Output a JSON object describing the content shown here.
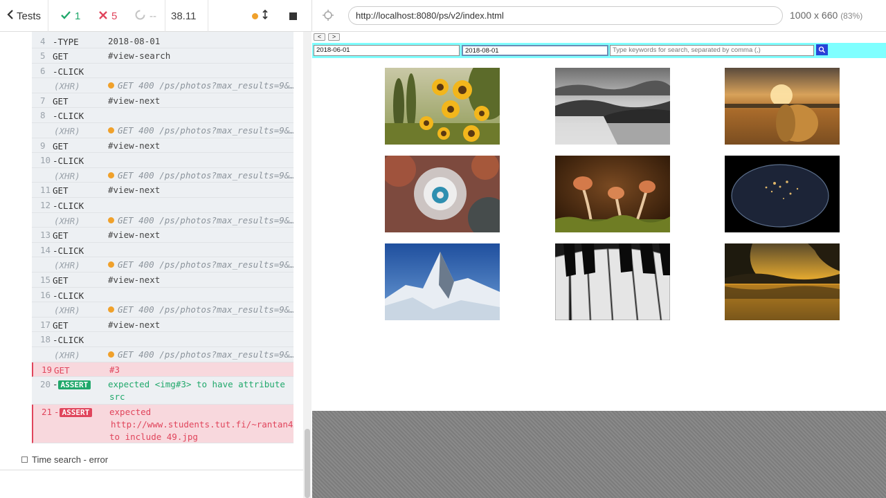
{
  "reporter": {
    "tests_label": "Tests",
    "passed_count": "1",
    "failed_count": "5",
    "pending_count": "--",
    "duration": "38.11",
    "test_title": "Time search - error",
    "commands": [
      {
        "num": "4",
        "name": "-TYPE",
        "msg": "2018-08-01",
        "type": "cmd"
      },
      {
        "num": "5",
        "name": "GET",
        "msg": "#view-search",
        "type": "cmd"
      },
      {
        "num": "6",
        "name": "-CLICK",
        "msg": "",
        "type": "cmd"
      },
      {
        "num": "",
        "name": "(XHR)",
        "msg": "GET 400 /ps/photos?max_results=9&…",
        "type": "xhr"
      },
      {
        "num": "7",
        "name": "GET",
        "msg": "#view-next",
        "type": "cmd"
      },
      {
        "num": "8",
        "name": "-CLICK",
        "msg": "",
        "type": "cmd"
      },
      {
        "num": "",
        "name": "(XHR)",
        "msg": "GET 400 /ps/photos?max_results=9&…",
        "type": "xhr"
      },
      {
        "num": "9",
        "name": "GET",
        "msg": "#view-next",
        "type": "cmd"
      },
      {
        "num": "10",
        "name": "-CLICK",
        "msg": "",
        "type": "cmd"
      },
      {
        "num": "",
        "name": "(XHR)",
        "msg": "GET 400 /ps/photos?max_results=9&…",
        "type": "xhr"
      },
      {
        "num": "11",
        "name": "GET",
        "msg": "#view-next",
        "type": "cmd"
      },
      {
        "num": "12",
        "name": "-CLICK",
        "msg": "",
        "type": "cmd"
      },
      {
        "num": "",
        "name": "(XHR)",
        "msg": "GET 400 /ps/photos?max_results=9&…",
        "type": "xhr"
      },
      {
        "num": "13",
        "name": "GET",
        "msg": "#view-next",
        "type": "cmd"
      },
      {
        "num": "14",
        "name": "-CLICK",
        "msg": "",
        "type": "cmd"
      },
      {
        "num": "",
        "name": "(XHR)",
        "msg": "GET 400 /ps/photos?max_results=9&…",
        "type": "xhr"
      },
      {
        "num": "15",
        "name": "GET",
        "msg": "#view-next",
        "type": "cmd"
      },
      {
        "num": "16",
        "name": "-CLICK",
        "msg": "",
        "type": "cmd"
      },
      {
        "num": "",
        "name": "(XHR)",
        "msg": "GET 400 /ps/photos?max_results=9&…",
        "type": "xhr"
      },
      {
        "num": "17",
        "name": "GET",
        "msg": "#view-next",
        "type": "cmd"
      },
      {
        "num": "18",
        "name": "-CLICK",
        "msg": "",
        "type": "cmd"
      },
      {
        "num": "",
        "name": "(XHR)",
        "msg": "GET 400 /ps/photos?max_results=9&…",
        "type": "xhr"
      },
      {
        "num": "19",
        "name": "GET",
        "msg": "#3",
        "type": "failed"
      }
    ],
    "assert_pass": {
      "num": "20",
      "badge": "ASSERT",
      "line1": "expected <img#3> to have attribute",
      "line2": "src"
    },
    "assert_fail": {
      "num": "21",
      "badge": "ASSERT",
      "line1": "expected",
      "line2": "http://www.students.tut.fi/~rantan4…",
      "line3": "to include 49.jpg"
    }
  },
  "preview": {
    "url": "http://localhost:8080/ps/v2/index.html",
    "viewport_size": "1000 x 660",
    "viewport_scale": "(83%)"
  },
  "app": {
    "prev_label": "<",
    "next_label": ">",
    "date_from": "2018-06-01",
    "date_to": "2018-08-01",
    "keywords_placeholder": "Type keywords for search, separated by comma (,)",
    "photos": [
      "sunflowers",
      "misty-valley",
      "hay-bale-sunset",
      "dandelion",
      "mushrooms",
      "earth-at-night",
      "matterhorn",
      "piano-keys",
      "sunset-lake"
    ]
  },
  "colors": {
    "pass": "#20a86b",
    "fail": "#e0455c",
    "pending_dot": "#f0a12b",
    "search_strip": "#7fffff",
    "search_button": "#1f4bd6"
  }
}
